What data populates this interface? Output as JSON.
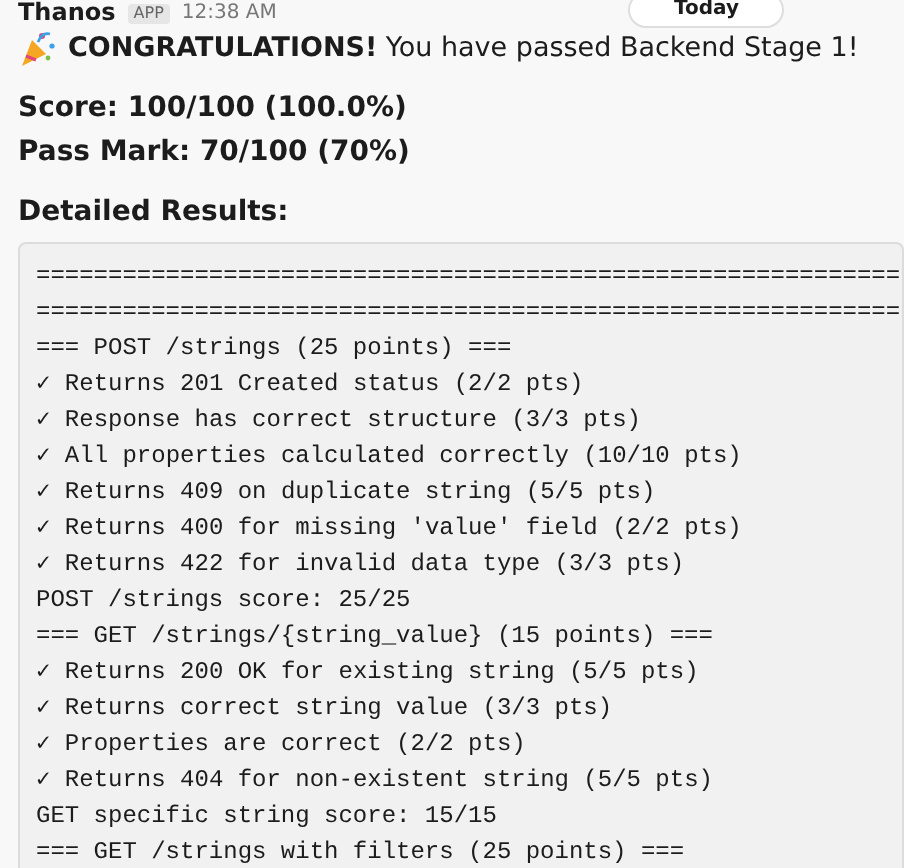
{
  "message": {
    "sender": "Thanos",
    "badge": "APP",
    "time": "12:38 AM",
    "date_divider": "Today",
    "headline": "**CONGRATULATIONS!** You have passed Backend Stage 1!",
    "summary": [
      "Score: 100/100 (100.0%)",
      "Pass Mark: 70/100 (70%)"
    ],
    "results_label": "Detailed Results:",
    "code_lines": [
      "============================================================",
      "============================================================",
      "=== POST /strings (25 points) ===",
      "✓ Returns 201 Created status (2/2 pts)",
      "✓ Response has correct structure (3/3 pts)",
      "✓ All properties calculated correctly (10/10 pts)",
      "✓ Returns 409 on duplicate string (5/5 pts)",
      "✓ Returns 400 for missing 'value' field (2/2 pts)",
      "✓ Returns 422 for invalid data type (3/3 pts)",
      "POST /strings score: 25/25",
      "=== GET /strings/{string_value} (15 points) ===",
      "✓ Returns 200 OK for existing string (5/5 pts)",
      "✓ Returns correct string value (3/3 pts)",
      "✓ Properties are correct (2/2 pts)",
      "✓ Returns 404 for non-existent string (5/5 pts)",
      "GET specific string score: 15/15",
      "=== GET /strings with filters (25 points) ==="
    ]
  }
}
